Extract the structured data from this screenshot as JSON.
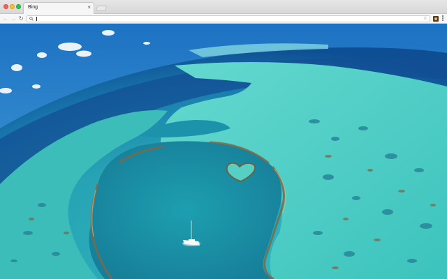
{
  "window": {
    "traffic_lights": {
      "close_color": "#fc5f57",
      "minimize_color": "#fdbc2e",
      "maximize_color": "#28c840"
    }
  },
  "tabs": [
    {
      "title": "Bing",
      "close_glyph": "×",
      "active": true
    }
  ],
  "toolbar": {
    "back_icon": "arrow-left-icon",
    "forward_icon": "arrow-right-icon",
    "reload_icon": "reload-icon",
    "address": {
      "value": "",
      "placeholder": ""
    },
    "bookmark_icon": "star-icon",
    "extension_icon": "extension-icon",
    "menu_icon": "vertical-dots-menu-icon"
  },
  "page": {
    "background_image": "aerial-coral-reef-heart-reef-photo",
    "colors": {
      "sky": "#2f86c9",
      "deep_ocean": "#0f4f8f",
      "lagoon": "#1f9fae",
      "reef": "#4fd0c4"
    }
  }
}
